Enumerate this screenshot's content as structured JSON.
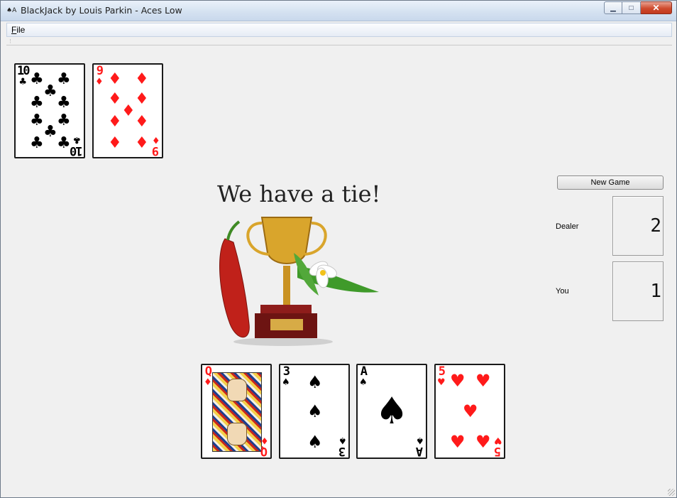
{
  "window": {
    "title": "BlackJack by Louis Parkin - Aces Low",
    "app_icon": "♠A",
    "controls": {
      "minimize": "▁",
      "maximize": "□",
      "close": "✕"
    }
  },
  "menu": {
    "file": "File",
    "file_mnemonic": "F",
    "file_rest": "ile"
  },
  "dealer_cards": [
    {
      "rank": "10",
      "suit": "♣",
      "color": "black"
    },
    {
      "rank": "9",
      "suit": "♦",
      "color": "red"
    }
  ],
  "player_cards": [
    {
      "rank": "Q",
      "suit": "♦",
      "color": "red"
    },
    {
      "rank": "3",
      "suit": "♠",
      "color": "black"
    },
    {
      "rank": "A",
      "suit": "♠",
      "color": "black"
    },
    {
      "rank": "5",
      "suit": "♥",
      "color": "red"
    }
  ],
  "result_message": "We have a tie!",
  "controls": {
    "new_game": "New Game"
  },
  "scores": {
    "dealer_label": "Dealer",
    "dealer_value": "2",
    "you_label": "You",
    "you_value": "1"
  },
  "colors": {
    "red_suit": "#ff1a1a",
    "black_suit": "#000000",
    "background": "#f0f0f0"
  }
}
